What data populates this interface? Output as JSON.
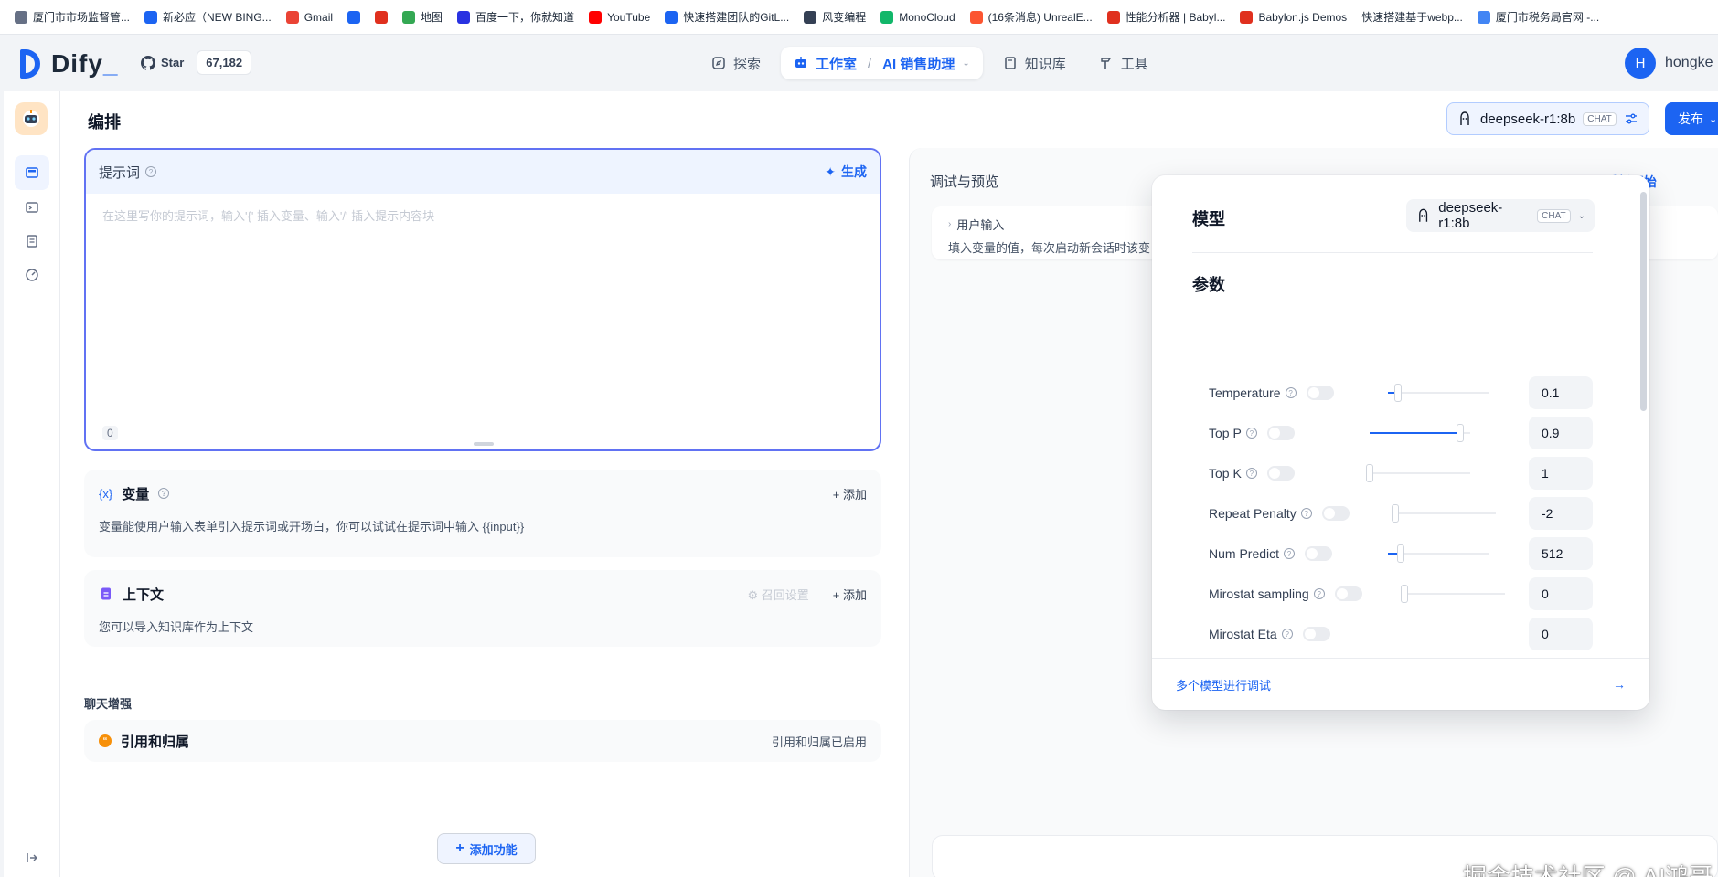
{
  "bookmarks": [
    {
      "label": "厦门市市场监督管...",
      "icon": "doc-icon",
      "color": "#667085"
    },
    {
      "label": "新必应（NEW BING...",
      "icon": "zhihu-icon",
      "color": "#1c64f2"
    },
    {
      "label": "Gmail",
      "icon": "gmail-icon",
      "color": "#ea4335"
    },
    {
      "label": "",
      "icon": "zhihu-icon",
      "color": "#1c64f2"
    },
    {
      "label": "",
      "icon": "weibo-icon",
      "color": "#e0301e"
    },
    {
      "label": "地图",
      "icon": "map-pin-icon",
      "color": "#34a853"
    },
    {
      "label": "百度一下，你就知道",
      "icon": "baidu-icon",
      "color": "#2932e1"
    },
    {
      "label": "YouTube",
      "icon": "youtube-icon",
      "color": "#ff0000"
    },
    {
      "label": "快速搭建团队的GitL...",
      "icon": "cloud-icon",
      "color": "#1c64f2"
    },
    {
      "label": "风变编程",
      "icon": "panda-icon",
      "color": "#344054"
    },
    {
      "label": "MonoCloud",
      "icon": "monocloud-icon",
      "color": "#12b76a"
    },
    {
      "label": "(16条消息) UnrealE...",
      "icon": "csdn-icon",
      "color": "#fc5531"
    },
    {
      "label": "性能分析器 | Babyl...",
      "icon": "babylon-icon",
      "color": "#e0301e"
    },
    {
      "label": "Babylon.js Demos",
      "icon": "babylon-icon",
      "color": "#e0301e"
    },
    {
      "label": "快速搭建基于webp...",
      "icon": "",
      "color": ""
    },
    {
      "label": "厦门市税务局官网 -...",
      "icon": "chrome-icon",
      "color": "#4285f4"
    }
  ],
  "brand": {
    "name": "Dify",
    "cursor": "_"
  },
  "github": {
    "star_label": "Star",
    "star_count": "67,182"
  },
  "nav": {
    "explore": "探索",
    "studio": "工作室",
    "app_name": "AI 销售助理",
    "knowledge": "知识库",
    "tools": "工具"
  },
  "user": {
    "initial": "H",
    "name": "hongke"
  },
  "page": {
    "title": "编排"
  },
  "model_chip": {
    "name": "deepseek-r1:8b",
    "tag": "CHAT"
  },
  "publish_label": "发布",
  "prompt": {
    "title": "提示词",
    "generate": "生成",
    "placeholder": "在这里写你的提示词，输入'{' 插入变量、输入'/' 插入提示内容块",
    "count": "0"
  },
  "variables": {
    "title": "变量",
    "add": "添加",
    "desc": "变量能使用户输入表单引入提示词或开场白，你可以试试在提示词中输入 {{input}}"
  },
  "context": {
    "title": "上下文",
    "recall": "召回设置",
    "add": "添加",
    "desc": "您可以导入知识库作为上下文"
  },
  "chat_enhance": {
    "label": "聊天增强"
  },
  "citation": {
    "title": "引用和归属",
    "status": "引用和归属已启用"
  },
  "add_feature": "添加功能",
  "debug": {
    "title": "调试与预览",
    "restart": "重新开始",
    "user_input_title": "用户输入",
    "user_input_desc": "填入变量的值，每次启动新会话时该变"
  },
  "popover": {
    "model_label": "模型",
    "model_name": "deepseek-r1:8b",
    "model_tag": "CHAT",
    "params_label": "参数",
    "footer": "多个模型进行调试",
    "params": [
      {
        "name": "Temperature",
        "value": "0.1",
        "level": 0.1,
        "enabled": false
      },
      {
        "name": "Top P",
        "value": "0.9",
        "level": 0.9,
        "enabled": false
      },
      {
        "name": "Top K",
        "value": "1",
        "level": 0.0,
        "enabled": false
      },
      {
        "name": "Repeat Penalty",
        "value": "-2",
        "level": 0.0,
        "enabled": false
      },
      {
        "name": "Num Predict",
        "value": "512",
        "level": 0.13,
        "enabled": false
      },
      {
        "name": "Mirostat sampling",
        "value": "0",
        "level": 0.0,
        "enabled": false
      },
      {
        "name": "Mirostat Eta",
        "value": "0",
        "level": null,
        "enabled": false
      }
    ]
  },
  "watermark": "掘金技术社区 @ AI鸿哥",
  "colors": {
    "accent": "#1c64f2",
    "prompt_border": "#6172f3"
  }
}
